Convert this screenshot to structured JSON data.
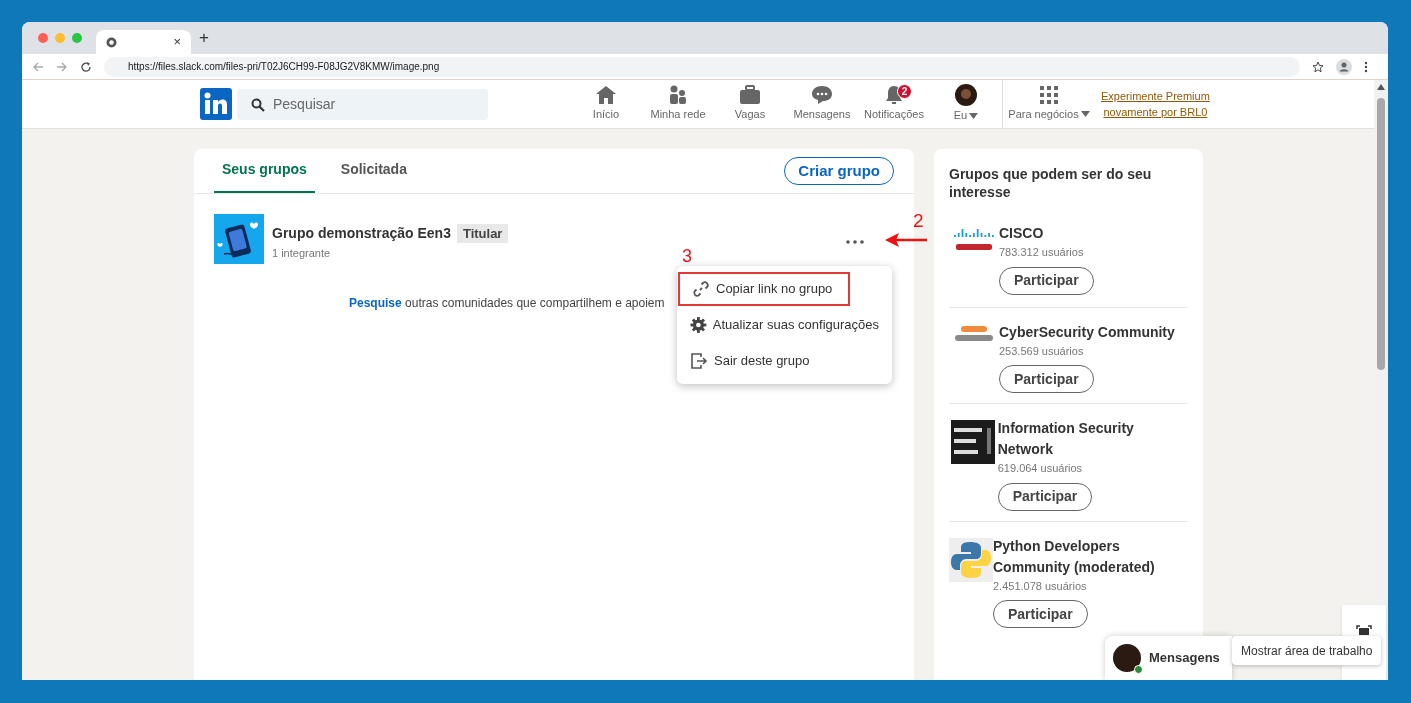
{
  "browser": {
    "tab_close": "×",
    "new_tab": "+",
    "url": "https://files.slack.com/files-pri/T02J6CH99-F08JG2V8KMW/image.png"
  },
  "nav": {
    "search_placeholder": "Pesquisar",
    "items": [
      {
        "kind": "home",
        "label": "Início"
      },
      {
        "kind": "network",
        "label": "Minha rede"
      },
      {
        "kind": "jobs",
        "label": "Vagas"
      },
      {
        "kind": "messages",
        "label": "Mensagens"
      },
      {
        "kind": "bell",
        "label": "Notificações",
        "badge": "2"
      },
      {
        "kind": "avatar",
        "label": "Eu"
      }
    ],
    "business": "Para negócios",
    "premium": [
      "Experimente Premium",
      "novamente por BRL0"
    ]
  },
  "groups": {
    "tabs": [
      {
        "label": "Seus grupos",
        "selected": true
      },
      {
        "label": "Solicitada",
        "selected": false
      }
    ],
    "create_button": "Criar grupo",
    "group": {
      "name": "Grupo demonstração Een3",
      "badge": "Titular",
      "members": "1 integrante"
    },
    "search_link": "Pesquise",
    "search_text": "outras comunidades que compartilhem e apoiem",
    "menu": [
      {
        "kind": "link",
        "label": "Copiar link no grupo",
        "outlined": true
      },
      {
        "kind": "gear",
        "label": "Atualizar suas configurações",
        "outlined": false
      },
      {
        "kind": "exit",
        "label": "Sair deste grupo",
        "outlined": false
      }
    ],
    "annotations": {
      "arrow_label": "2",
      "box_label": "3"
    }
  },
  "suggestions": {
    "title": "Grupos que podem ser do seu interesse",
    "items": [
      {
        "kind": "bars",
        "name": "CISCO",
        "members": "783.312 usuários",
        "button": "Participar"
      },
      {
        "kind": "cyber",
        "name": "CyberSecurity Community",
        "members": "253.569 usuários",
        "button": "Participar"
      },
      {
        "kind": "dark",
        "name": "Information Security Network",
        "members": "619.064 usuários",
        "button": "Participar"
      },
      {
        "kind": "snakes",
        "name": "Python Developers Community (moderated)",
        "members": "2.451.078 usuários",
        "button": "Participar"
      }
    ]
  },
  "messaging": {
    "label": "Mensagens"
  },
  "tooltip": "Mostrar área de trabalho"
}
